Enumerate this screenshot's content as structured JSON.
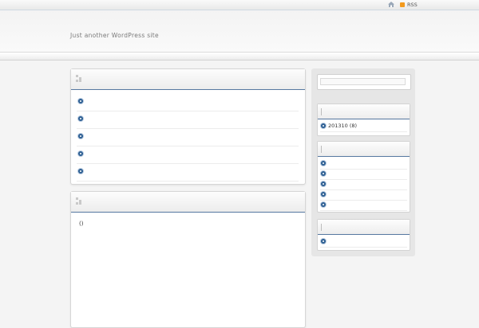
{
  "topbar": {
    "home_icon": "home-icon",
    "rss_icon": "rss-feed-icon",
    "rss_label": "RSS",
    "accent": "#f39a1d"
  },
  "header": {
    "tagline": "Just another WordPress site"
  },
  "main": {
    "recent_posts_panel": {
      "items": [
        "",
        "",
        "",
        "",
        ""
      ]
    },
    "content_panel": {
      "text": "()"
    }
  },
  "sidebar": {
    "archives": {
      "items": [
        {
          "label": "201310 (8)"
        }
      ]
    },
    "categories": {
      "items": [
        "",
        "",
        "",
        "",
        ""
      ]
    },
    "meta": {
      "items": [
        ""
      ]
    }
  },
  "colors": {
    "accent_line": "#5678a0",
    "bullet": "#2d5f93",
    "background": "#f4f4f4"
  }
}
